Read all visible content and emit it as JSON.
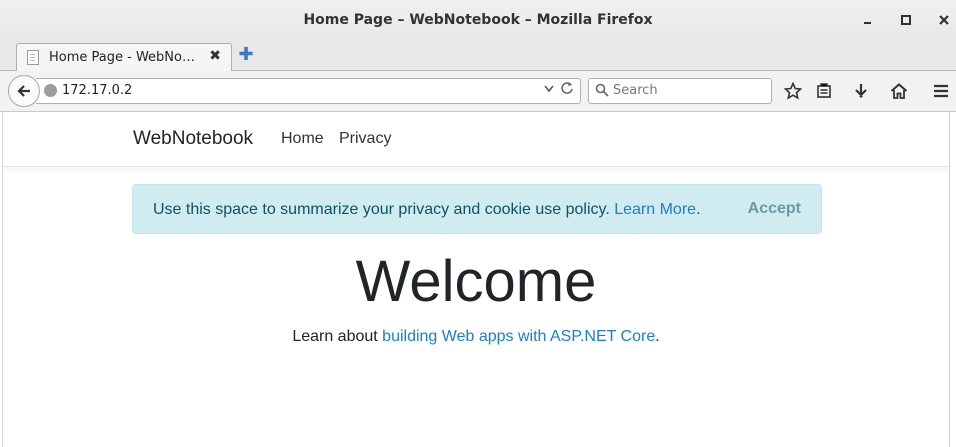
{
  "window": {
    "title": "Home Page – WebNotebook – Mozilla Firefox",
    "minimize_icon": "minimize-icon",
    "maximize_icon": "maximize-icon",
    "close_icon": "close-icon"
  },
  "tabs": [
    {
      "label": "Home Page - WebNo…",
      "icon": "page-icon",
      "close": "✖"
    }
  ],
  "new_tab_symbol": "✚",
  "navbar": {
    "url": "172.17.0.2",
    "search_placeholder": "Search",
    "icons": [
      "back-arrow-icon",
      "globe-icon",
      "dropdown-icon",
      "reload-icon",
      "search-icon",
      "bookmark-star-icon",
      "reading-list-icon",
      "download-icon",
      "home-icon",
      "menu-icon"
    ]
  },
  "site": {
    "brand": "WebNotebook",
    "nav": [
      "Home",
      "Privacy"
    ],
    "cookie": {
      "text": "Use this space to summarize your privacy and cookie use policy. ",
      "link": "Learn More",
      "after_link": ".",
      "accept": "Accept"
    },
    "welcome": "Welcome",
    "learn_prefix": "Learn about ",
    "learn_link": "building Web apps with ASP.NET Core",
    "learn_suffix": "."
  },
  "colors": {
    "alert_bg": "#d1ecf1",
    "alert_text": "#0c5460",
    "link": "#1b7fc4"
  }
}
